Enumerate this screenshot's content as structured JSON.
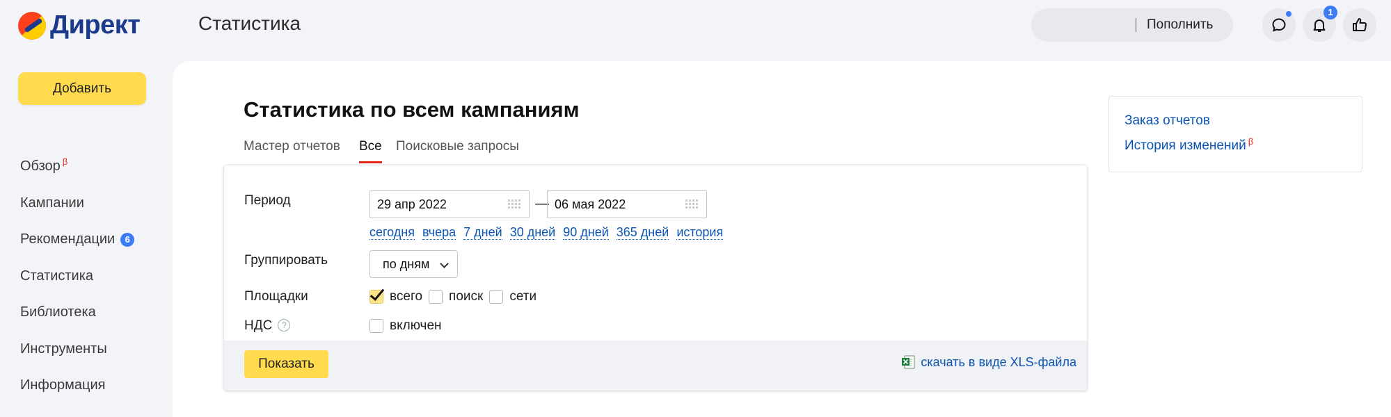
{
  "header": {
    "logo_text": "Директ",
    "title": "Статистика",
    "topup_label": "Пополнить",
    "notifications_count": "1",
    "icons": [
      "chat-icon",
      "bell-icon",
      "thumbs-up-icon"
    ]
  },
  "sidebar": {
    "add_button": "Добавить",
    "items": [
      {
        "label": "Обзор",
        "beta": "β"
      },
      {
        "label": "Кампании"
      },
      {
        "label": "Рекомендации",
        "badge": "6"
      },
      {
        "label": "Статистика"
      },
      {
        "label": "Библиотека"
      },
      {
        "label": "Инструменты"
      },
      {
        "label": "Информация"
      }
    ]
  },
  "main": {
    "title": "Статистика по всем кампаниям",
    "tabs": [
      {
        "label": "Мастер отчетов",
        "active": false
      },
      {
        "label": "Все",
        "active": true
      },
      {
        "label": "Поисковые запросы",
        "active": false
      }
    ],
    "form": {
      "period_label": "Период",
      "date_from": "29 апр 2022",
      "date_to": "06 мая 2022",
      "dash": "—",
      "quick_periods": [
        "сегодня",
        "вчера",
        "7 дней",
        "30 дней",
        "90 дней",
        "365 дней",
        "история"
      ],
      "group_label": "Группировать",
      "group_value": "по дням",
      "platforms_label": "Площадки",
      "platforms": [
        {
          "label": "всего",
          "checked": true
        },
        {
          "label": "поиск",
          "checked": false
        },
        {
          "label": "сети",
          "checked": false
        }
      ],
      "vat_label": "НДС",
      "vat_help": "?",
      "vat_option": {
        "label": "включен",
        "checked": false
      }
    },
    "footer": {
      "show_button": "Показать",
      "xls_link": "скачать в виде XLS-файла"
    }
  },
  "side_panel": {
    "links": [
      {
        "label": "Заказ отчетов"
      },
      {
        "label": "История изменений",
        "beta": "β"
      }
    ]
  },
  "colors": {
    "accent_yellow": "#ffdb4d",
    "link_blue": "#0b55b5",
    "active_tab_red": "#e0281c",
    "badge_blue": "#3d7cf7"
  }
}
